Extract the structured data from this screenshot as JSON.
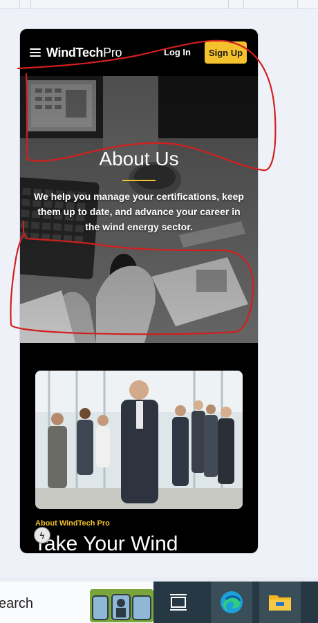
{
  "nav": {
    "brand_bold": "WindTech",
    "brand_light": "Pro",
    "login_label": "Log In",
    "signup_label": "Sign Up"
  },
  "hero": {
    "title": "About Us",
    "text": "We help you manage your certifications, keep them up to date, and advance your career in the wind energy sector."
  },
  "about": {
    "eyebrow": "About WindTech Pro",
    "headline": "Take Your Wind"
  },
  "taskbar": {
    "search_text": "earch"
  },
  "colors": {
    "accent": "#f4c22d",
    "annotation": "#d21f1f",
    "taskbar_dark": "#253844"
  },
  "icons": [
    "hamburger-menu-icon",
    "lightning-icon",
    "task-view-icon",
    "edge-browser-icon",
    "file-explorer-icon"
  ]
}
